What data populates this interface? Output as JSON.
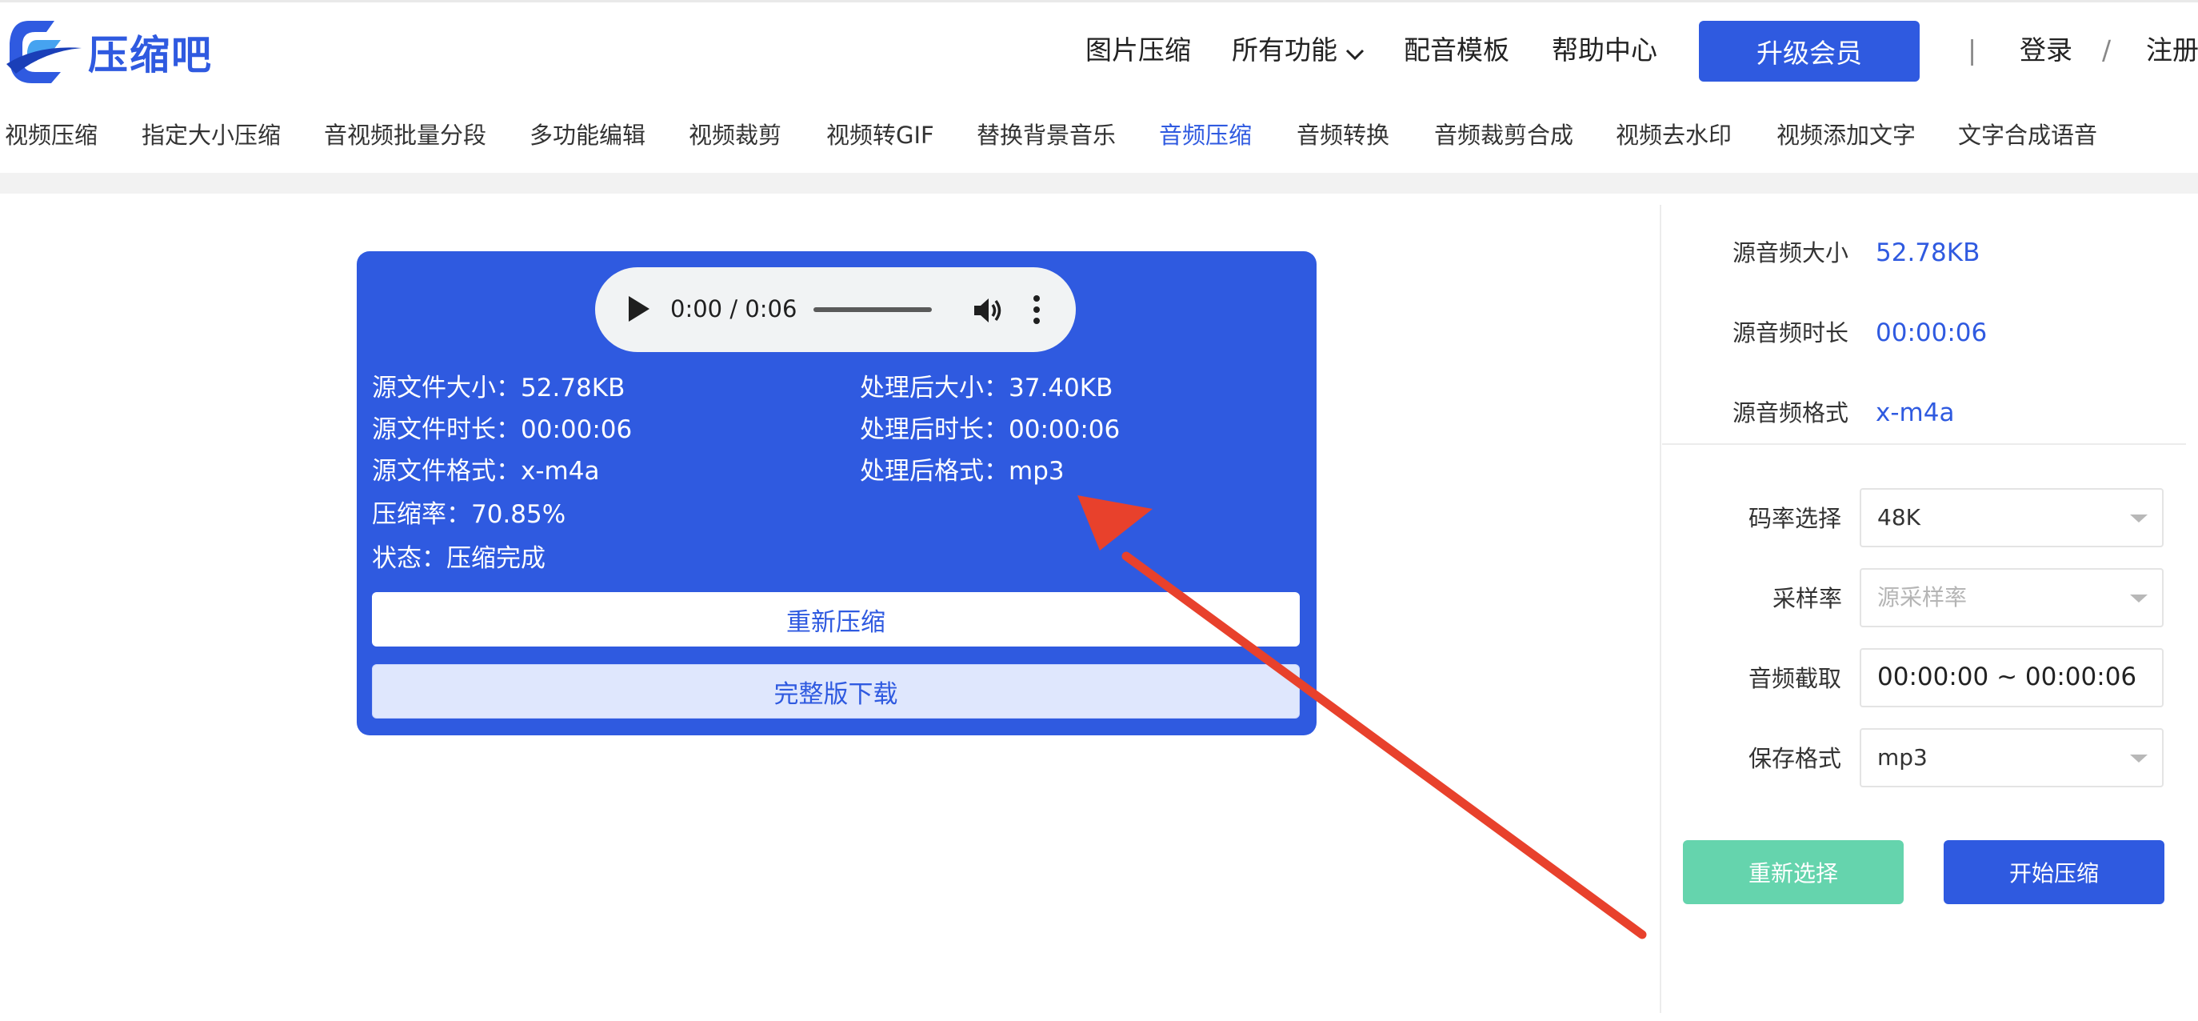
{
  "header": {
    "logo_text": "压缩吧",
    "nav": [
      {
        "label": "图片压缩"
      },
      {
        "label": "所有功能"
      },
      {
        "label": "配音模板"
      },
      {
        "label": "帮助中心"
      }
    ],
    "upgrade_label": "升级会员",
    "divider": "|",
    "login_label": "登录",
    "slash": "/",
    "register_label": "注册"
  },
  "tabs": [
    {
      "label": "视频压缩"
    },
    {
      "label": "指定大小压缩"
    },
    {
      "label": "音视频批量分段"
    },
    {
      "label": "多功能编辑"
    },
    {
      "label": "视频裁剪"
    },
    {
      "label": "视频转GIF"
    },
    {
      "label": "替换背景音乐"
    },
    {
      "label": "音频压缩",
      "active": true
    },
    {
      "label": "音频转换"
    },
    {
      "label": "音频裁剪合成"
    },
    {
      "label": "视频去水印"
    },
    {
      "label": "视频添加文字"
    },
    {
      "label": "文字合成语音"
    }
  ],
  "player": {
    "time": "0:00 / 0:06",
    "progress": 0
  },
  "result": {
    "src_size": "源文件大小：52.78KB",
    "src_duration": "源文件时长：00:00:06",
    "src_format": "源文件格式：x-m4a",
    "out_size": "处理后大小：37.40KB",
    "out_duration": "处理后时长：00:00:06",
    "out_format": "处理后格式：mp3",
    "ratio": "压缩率：70.85%",
    "status": "状态：压缩完成",
    "recompress_label": "重新压缩",
    "download_label": "完整版下载"
  },
  "panel": {
    "size_label": "源音频大小",
    "size_value": "52.78KB",
    "duration_label": "源音频时长",
    "duration_value": "00:00:06",
    "format_label": "源音频格式",
    "format_value": "x-m4a",
    "bitrate_label": "码率选择",
    "bitrate_value": "48K",
    "samplerate_label": "采样率",
    "samplerate_placeholder": "源采样率",
    "trim_label": "音频截取",
    "trim_value": "00:00:00 ~ 00:00:06",
    "save_format_label": "保存格式",
    "save_format_value": "mp3",
    "reselect_label": "重新选择",
    "start_label": "开始压缩"
  },
  "colors": {
    "brand": "#2f5ae0",
    "reselect_button": "#65d4ad",
    "annotation_arrow": "#e8412c"
  },
  "icons": [
    "logo-icon",
    "chevron-down-icon",
    "play-icon",
    "volume-icon",
    "more-vert-icon",
    "caret-down-icon"
  ]
}
